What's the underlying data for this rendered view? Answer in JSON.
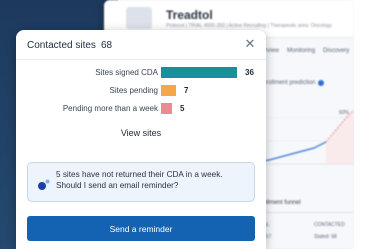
{
  "background": {
    "app_title": "Treadtol",
    "meta": "Protocol | TRIAL 4930-393 | Active Recruiting | Therapeutic area: Oncology",
    "tabs": [
      "Overview",
      "Monitoring",
      "Discovery"
    ],
    "prediction_label": "Enrollment prediction",
    "chart_percent": "60%",
    "funnel_title": "Enrollment funnel",
    "funnel_col_left": "TOTAL",
    "funnel_col_right": "CONTACTED",
    "funnel_left_value": "Stat: 57",
    "funnel_right_value": "Stated: 68"
  },
  "popover": {
    "title": "Contacted sites",
    "count": "68",
    "close_icon": "close-icon",
    "view_sites_label": "View sites",
    "reminder_icon": "ai-sparkle-icon",
    "reminder_text": "5 sites have not returned their CDA in a week. Should I send an email reminder?",
    "send_button_label": "Send a reminder"
  },
  "chart_data": {
    "type": "bar",
    "orientation": "horizontal",
    "categories": [
      "Sites signed CDA",
      "Sites pending",
      "Pending more than a week"
    ],
    "values": [
      36,
      7,
      5
    ],
    "colors": [
      "#1a8f9a",
      "#f3a64a",
      "#ea8a93"
    ],
    "title": "",
    "xlabel": "",
    "ylabel": ""
  }
}
